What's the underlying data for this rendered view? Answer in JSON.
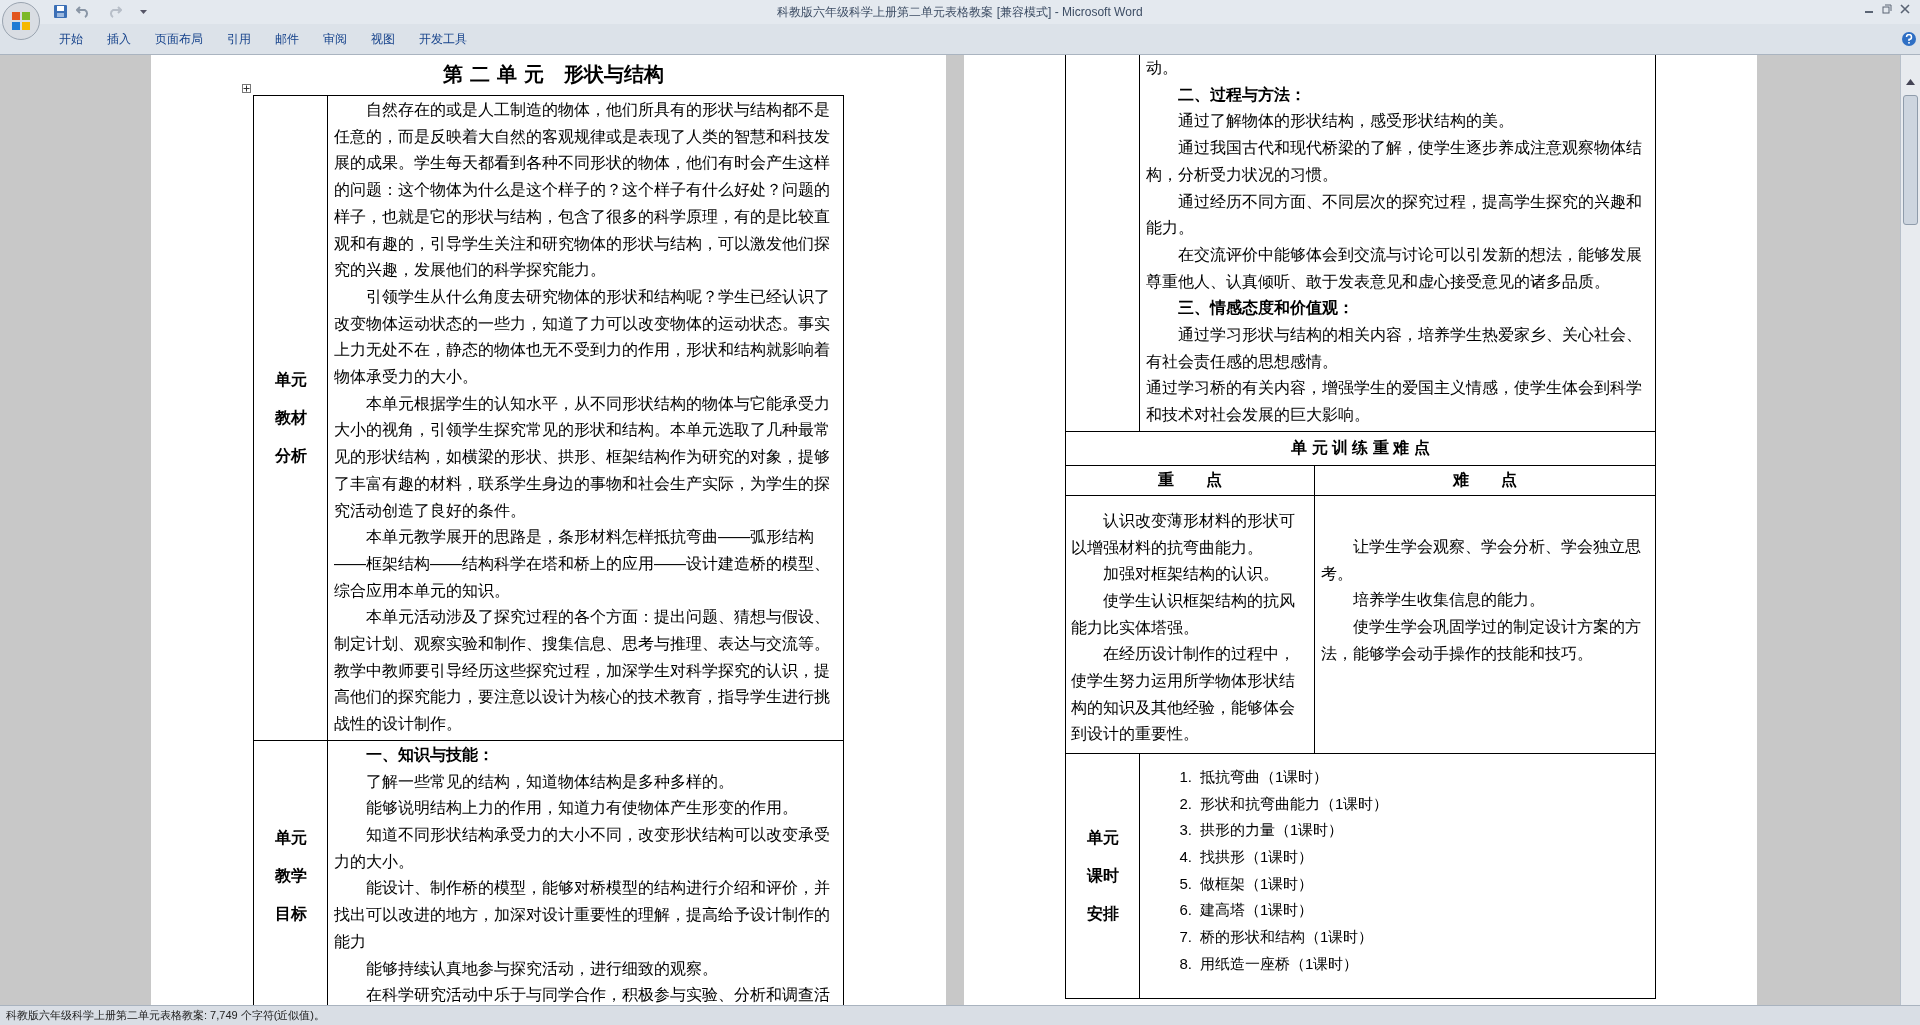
{
  "window": {
    "title": "科教版六年级科学上册第二单元表格教案 [兼容模式] - Microsoft Word"
  },
  "ribbon_tabs": [
    {
      "label": "开始"
    },
    {
      "label": "插入"
    },
    {
      "label": "页面布局"
    },
    {
      "label": "引用"
    },
    {
      "label": "邮件"
    },
    {
      "label": "审阅"
    },
    {
      "label": "视图"
    },
    {
      "label": "开发工具"
    }
  ],
  "left_page": {
    "title": "第 二 单 元　形状与结构",
    "rows": [
      {
        "label": [
          "单元",
          "教材",
          "分析"
        ],
        "paragraphs": [
          {
            "kind": "body",
            "text": "自然存在的或是人工制造的物体，他们所具有的形状与结构都不是任意的，而是反映着大自然的客观规律或是表现了人类的智慧和科技发展的成果。学生每天都看到各种不同形状的物体，他们有时会产生这样的问题：这个物体为什么是这个样子的？这个样子有什么好处？问题的样子，也就是它的形状与结构，包含了很多的科学原理，有的是比较直观和有趣的，引导学生关注和研究物体的形状与结构，可以激发他们探究的兴趣，发展他们的科学探究能力。"
          },
          {
            "kind": "body",
            "text": "引领学生从什么角度去研究物体的形状和结构呢？学生已经认识了改变物体运动状态的一些力，知道了力可以改变物体的运动状态。事实上力无处不在，静态的物体也无不受到力的作用，形状和结构就影响着物体承受力的大小。"
          },
          {
            "kind": "body",
            "text": "本单元根据学生的认知水平，从不同形状结构的物体与它能承受力大小的视角，引领学生探究常见的形状和结构。本单元选取了几种最常见的形状结构，如横梁的形状、拱形、框架结构作为研究的对象，提够了丰富有趣的材料，联系学生身边的事物和社会生产实际，为学生的探究活动创造了良好的条件。"
          },
          {
            "kind": "body",
            "text": "本单元教学展开的思路是，条形材料怎样抵抗弯曲——弧形结构——框架结构——结构科学在塔和桥上的应用——设计建造桥的模型、综合应用本单元的知识。"
          },
          {
            "kind": "body",
            "text": "本单元活动涉及了探究过程的各个方面：提出问题、猜想与假设、制定计划、观察实验和制作、搜集信息、思考与推理、表达与交流等。教学中教师要引导经历这些探究过程，加深学生对科学探究的认识，提高他们的探究能力，要注意以设计为核心的技术教育，指导学生进行挑战性的设计制作。"
          }
        ]
      },
      {
        "label": [
          "单元",
          "教学",
          "目标"
        ],
        "paragraphs": [
          {
            "kind": "heading",
            "text": "一、知识与技能："
          },
          {
            "kind": "body",
            "text": "了解一些常见的结构，知道物体结构是多种多样的。"
          },
          {
            "kind": "body",
            "text": "能够说明结构上力的作用，知道力有使物体产生形变的作用。"
          },
          {
            "kind": "body",
            "text": "知道不同形状结构承受力的大小不同，改变形状结构可以改变承受力的大小。"
          },
          {
            "kind": "body",
            "text": "能设计、制作桥的模型，能够对桥模型的结构进行介绍和评价，并找出可以改进的地方，加深对设计重要性的理解，提高给予设计制作的能力"
          },
          {
            "kind": "body",
            "text": "能够持续认真地参与探究活动，进行细致的观察。"
          },
          {
            "kind": "body",
            "text": "在科学研究活动中乐于与同学合作，积极参与实验、分析和调查活"
          }
        ]
      }
    ]
  },
  "right_page": {
    "continued_paragraphs": [
      {
        "kind": "plain",
        "text": "动。"
      },
      {
        "kind": "heading",
        "text": "二、过程与方法："
      },
      {
        "kind": "body",
        "text": "通过了解物体的形状结构，感受形状结构的美。"
      },
      {
        "kind": "body",
        "text": "通过我国古代和现代桥梁的了解，使学生逐步养成注意观察物体结构，分析受力状况的习惯。"
      },
      {
        "kind": "body",
        "text": "通过经历不同方面、不同层次的探究过程，提高学生探究的兴趣和能力。"
      },
      {
        "kind": "body",
        "text": "在交流评价中能够体会到交流与讨论可以引发新的想法，能够发展尊重他人、认真倾听、敢于发表意见和虚心接受意见的诸多品质。"
      },
      {
        "kind": "heading",
        "text": "三、情感态度和价值观："
      },
      {
        "kind": "body",
        "text": "通过学习形状与结构的相关内容，培养学生热爱家乡、关心社会、有社会责任感的思想感情。"
      },
      {
        "kind": "plain",
        "text": "通过学习桥的有关内容，增强学生的爱国主义情感，使学生体会到科学和技术对社会发展的巨大影响。"
      }
    ],
    "key_points": {
      "title": "单 元 训 练 重 难 点",
      "columns": [
        {
          "heading": "重　　点",
          "paragraphs": [
            "认识改变薄形材料的形状可以增强材料的抗弯曲能力。",
            "加强对框架结构的认识。",
            "使学生认识框架结构的抗风能力比实体塔强。",
            "在经历设计制作的过程中，使学生努力运用所学物体形状结构的知识及其他经验，能够体会到设计的重要性。"
          ]
        },
        {
          "heading": "难　　点",
          "paragraphs": [
            "让学生学会观察、学会分析、学会独立思考。",
            "培养学生收集信息的能力。",
            "使学生学会巩固学过的制定设计方案的方法，能够学会动手操作的技能和技巧。"
          ]
        }
      ]
    },
    "schedule": {
      "label": [
        "单元",
        "课时",
        "安排"
      ],
      "items": [
        {
          "number": "1.",
          "text": "抵抗弯曲（1课时）"
        },
        {
          "number": "2.",
          "text": "形状和抗弯曲能力（1课时）"
        },
        {
          "number": "3.",
          "text": "拱形的力量（1课时）"
        },
        {
          "number": "4.",
          "text": "找拱形（1课时）"
        },
        {
          "number": "5.",
          "text": "做框架（1课时）"
        },
        {
          "number": "6.",
          "text": "建高塔（1课时）"
        },
        {
          "number": "7.",
          "text": "桥的形状和结构（1课时）"
        },
        {
          "number": "8.",
          "text": "用纸造一座桥（1课时）"
        }
      ]
    }
  },
  "status_bar": {
    "text": "科教版六年级科学上册第二单元表格教案: 7,749 个字符(近似值)。"
  }
}
